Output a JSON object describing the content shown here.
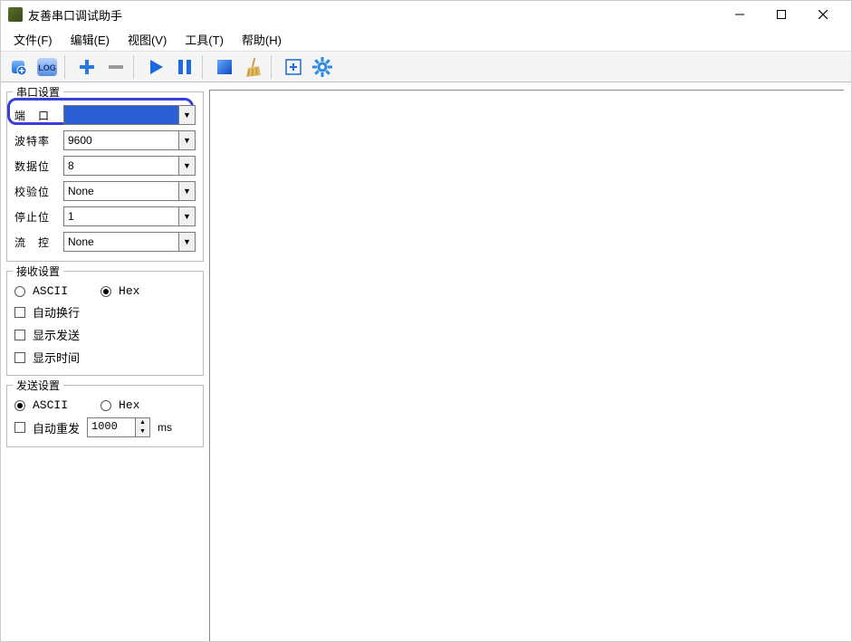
{
  "window": {
    "title": "友善串口调试助手"
  },
  "menu": {
    "file": "文件(F)",
    "edit": "编辑(E)",
    "view": "视图(V)",
    "tools": "工具(T)",
    "help": "帮助(H)"
  },
  "toolbar": {
    "log_label": "LOG"
  },
  "serial": {
    "group_title": "串口设置",
    "port_label": "端　口",
    "port_value": "",
    "baud_label": "波特率",
    "baud_value": "9600",
    "data_label": "数据位",
    "data_value": "8",
    "parity_label": "校验位",
    "parity_value": "None",
    "stop_label": "停止位",
    "stop_value": "1",
    "flow_label": "流　控",
    "flow_value": "None"
  },
  "receive": {
    "group_title": "接收设置",
    "ascii": "ASCII",
    "hex": "Hex",
    "auto_wrap": "自动换行",
    "show_send": "显示发送",
    "show_time": "显示时间"
  },
  "send": {
    "group_title": "发送设置",
    "ascii": "ASCII",
    "hex": "Hex",
    "auto_resend": "自动重发",
    "interval": "1000",
    "unit": "ms"
  }
}
